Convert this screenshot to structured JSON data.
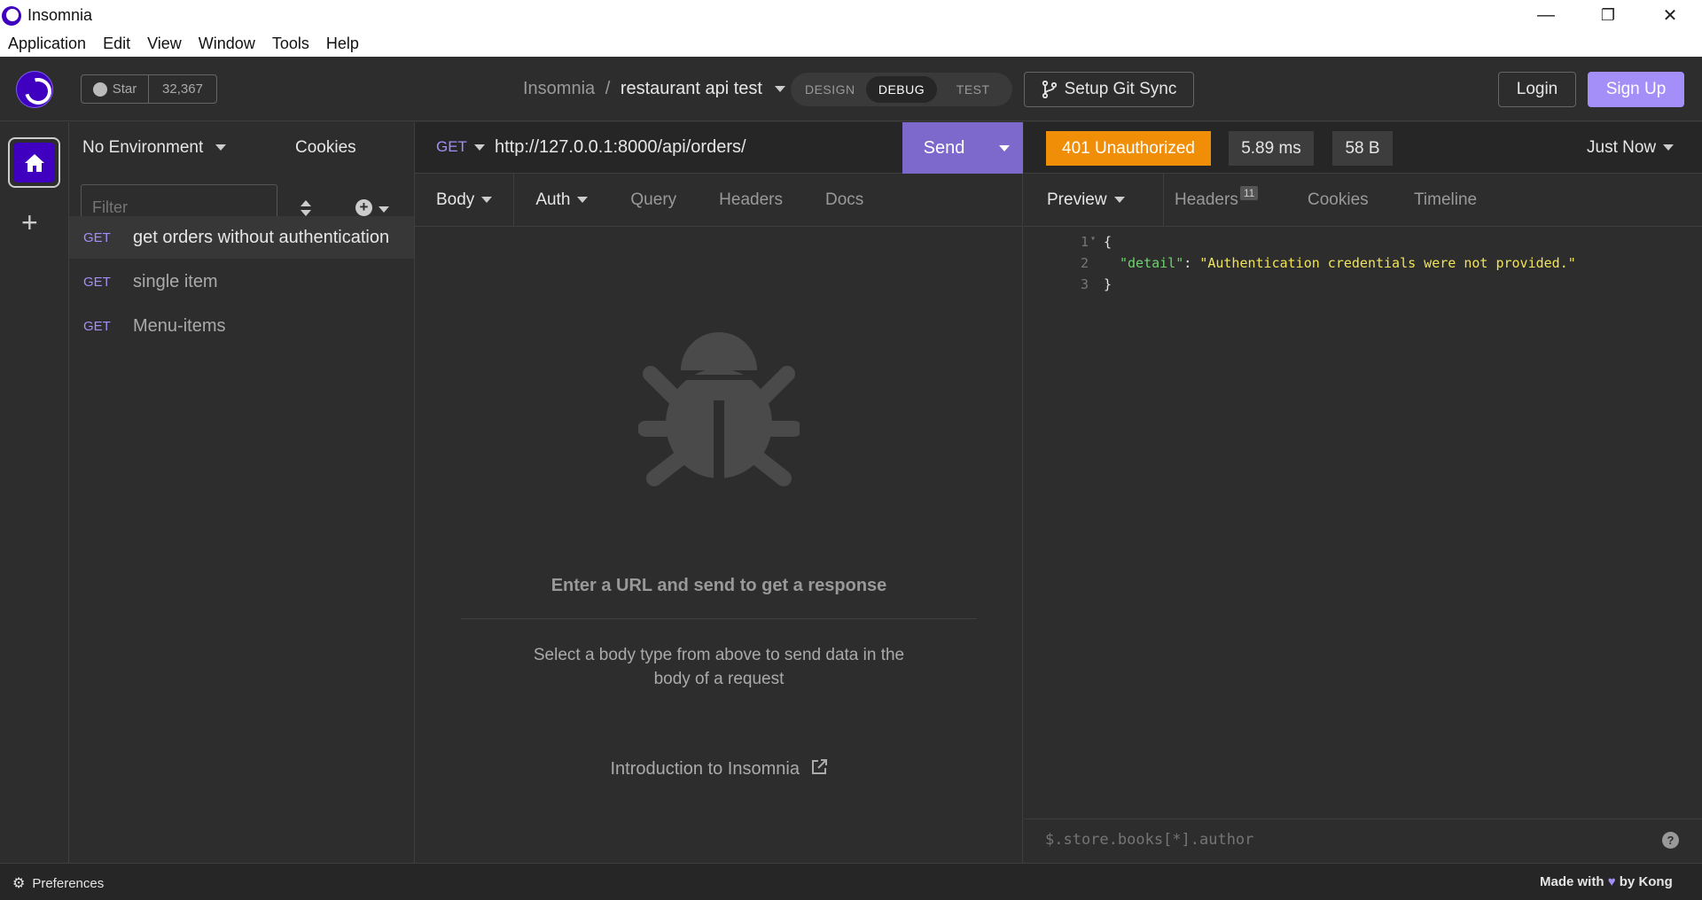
{
  "window": {
    "title": "Insomnia",
    "minimize": "—",
    "restore": "❐",
    "close": "✕"
  },
  "menu": [
    "Application",
    "Edit",
    "View",
    "Window",
    "Tools",
    "Help"
  ],
  "header": {
    "github": {
      "star_label": "Star",
      "star_count": "32,367"
    },
    "breadcrumb": {
      "root": "Insomnia",
      "separator": "/",
      "project": "restaurant api test"
    },
    "modes": [
      "DESIGN",
      "DEBUG",
      "TEST"
    ],
    "active_mode": "DEBUG",
    "git_sync_label": "Setup Git Sync",
    "login_label": "Login",
    "signup_label": "Sign Up"
  },
  "sidebar": {
    "environment": "No Environment",
    "cookies_label": "Cookies",
    "filter_placeholder": "Filter",
    "requests": [
      {
        "method": "GET",
        "name": "get orders without authentication",
        "active": true
      },
      {
        "method": "GET",
        "name": "single item",
        "active": false
      },
      {
        "method": "GET",
        "name": "Menu-items",
        "active": false
      }
    ]
  },
  "request": {
    "method": "GET",
    "url": "http://127.0.0.1:8000/api/orders/",
    "send_label": "Send",
    "tabs": [
      "Body",
      "Auth",
      "Query",
      "Headers",
      "Docs"
    ],
    "empty_title": "Enter a URL and send to get a response",
    "empty_subtitle": "Select a body type from above to send data in the body of a request",
    "intro_link": "Introduction to Insomnia"
  },
  "response": {
    "status": "401 Unauthorized",
    "time": "5.89 ms",
    "size": "58 B",
    "when": "Just Now",
    "tabs": {
      "preview": "Preview",
      "headers": "Headers",
      "headers_count": "11",
      "cookies": "Cookies",
      "timeline": "Timeline"
    },
    "body": {
      "line1": "{",
      "key": "\"detail\"",
      "colon": ": ",
      "value": "\"Authentication credentials were not provided.\"",
      "line3": "}"
    },
    "line_numbers": [
      "1",
      "2",
      "3"
    ],
    "jsonpath_placeholder": "$.store.books[*].author",
    "help": "?"
  },
  "footer": {
    "preferences_label": "Preferences",
    "made_with": "Made with",
    "by": "by Kong"
  },
  "colors": {
    "accent": "#a48ef7",
    "status_401": "#f18e08",
    "brand": "#4000bf"
  }
}
